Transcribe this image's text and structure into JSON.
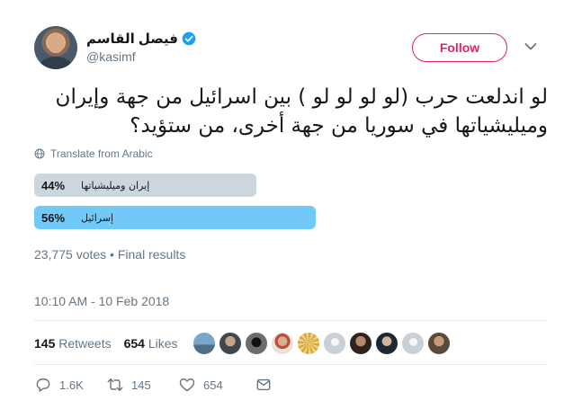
{
  "tweet": {
    "display_name": "فيصل القاسم",
    "handle": "@kasimf",
    "follow_label": "Follow",
    "text": "لو اندلعت حرب (لو لو لو لو ) بين اسرائيل من جهة وإيران وميليشياتها في سوريا من جهة أخرى، من ستؤيد؟",
    "translate_label": "Translate from Arabic",
    "poll": {
      "options": [
        {
          "percent": "44%",
          "label": "إيران وميليشياتها",
          "value": 0.44
        },
        {
          "percent": "56%",
          "label": "إسرائيل",
          "value": 0.56
        }
      ],
      "summary": "23,775 votes • Final results"
    },
    "timestamp": "10:10 AM - 10 Feb 2018",
    "stats": {
      "retweets_count": "145",
      "retweets_label": "Retweets",
      "likes_count": "654",
      "likes_label": "Likes"
    },
    "actions": {
      "reply_count": "1.6K",
      "retweet_count": "145",
      "like_count": "654"
    }
  },
  "colors": {
    "follow_accent": "#e0245e",
    "verified": "#1da1f2",
    "poll_winner": "#71c9f8",
    "poll_other": "#ccd6dd"
  }
}
